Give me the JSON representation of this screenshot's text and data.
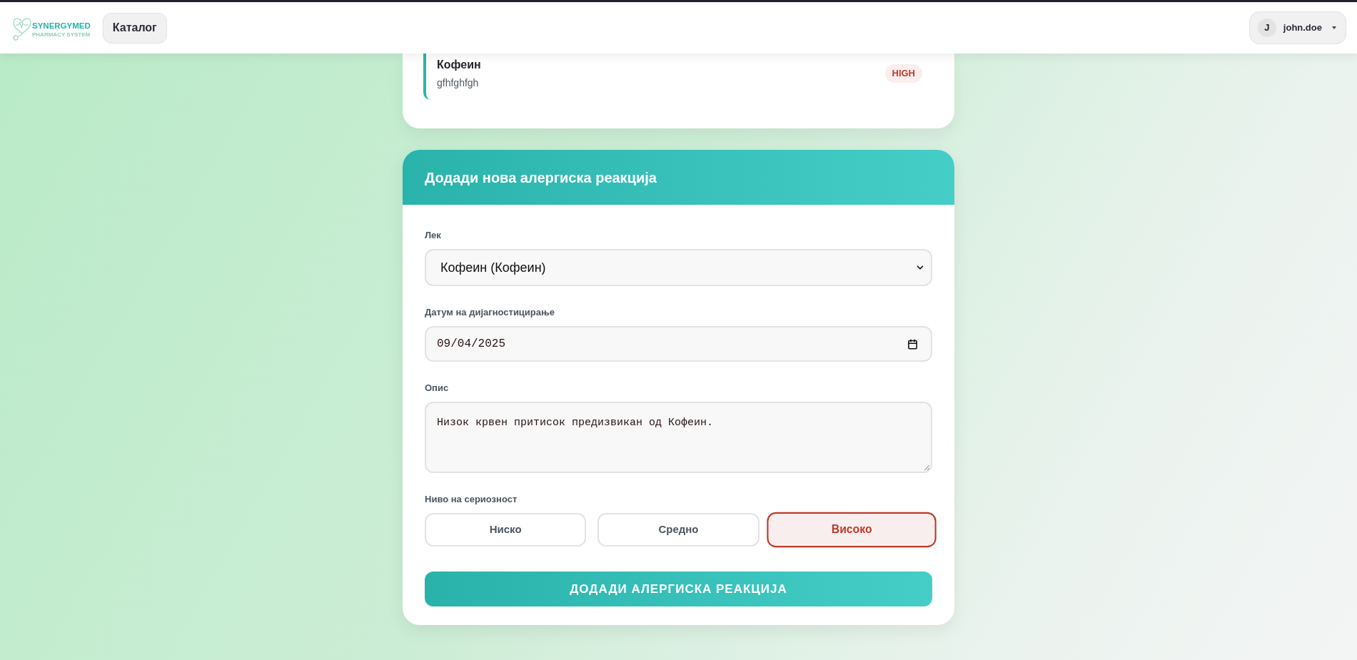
{
  "header": {
    "logo": {
      "name": "SYNERGYMED",
      "tagline": "PHARMACY SYSTEM"
    },
    "nav": [
      {
        "label": "Каталог"
      }
    ],
    "user": {
      "initial": "J",
      "name": "john.doe"
    }
  },
  "allergies": [
    {
      "drug": "Кофеин",
      "description": "gfhfghfgh",
      "severity": "HIGH"
    }
  ],
  "form": {
    "title": "Додади нова алергиска реакција",
    "fields": [
      {
        "kind": "select",
        "label": "Лек",
        "value": "Кофеин (Кофеин)"
      },
      {
        "kind": "date",
        "label": "Датум на дијагностицирање",
        "value": "09/04/2025"
      },
      {
        "kind": "textarea",
        "label": "Опис",
        "value": "Низок крвен притисок предизвикан од Кофеин."
      }
    ],
    "severity": {
      "label": "Ниво на сериозност",
      "options": [
        {
          "label": "Ниско",
          "selected": false
        },
        {
          "label": "Средно",
          "selected": false
        },
        {
          "label": "Високо",
          "selected": true
        }
      ]
    },
    "submit": "ДОДАДИ АЛЕРГИСКА РЕАКЦИЈА"
  }
}
